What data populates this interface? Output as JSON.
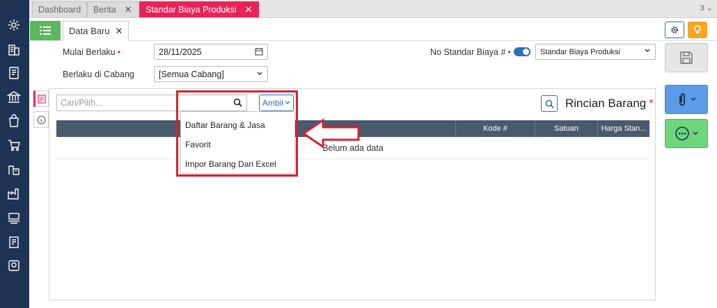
{
  "tabs": [
    {
      "label": "Dashboard",
      "closable": false
    },
    {
      "label": "Berita",
      "closable": true
    },
    {
      "label": "Standar Biaya Produksi",
      "closable": true,
      "active": true
    }
  ],
  "tab_count": "3",
  "doc_tab": {
    "label": "Data Baru"
  },
  "form": {
    "mulai_berlaku_label": "Mulai Berlaku",
    "mulai_berlaku_value": "28/11/2025",
    "berlaku_cabang_label": "Berlaku di Cabang",
    "berlaku_cabang_value": "[Semua Cabang]",
    "no_standar_label": "No Standar Biaya #",
    "no_standar_value": "Standar Biaya Produksi",
    "required_mark": "•"
  },
  "search": {
    "placeholder": "Cari/Pilih...",
    "ambil_label": "Ambil"
  },
  "rincian": {
    "title": "Rincian Barang",
    "required_mark": "*"
  },
  "table": {
    "columns": [
      "Kode #",
      "Satuan",
      "Harga Stan..."
    ],
    "empty_text": "Belum ada data"
  },
  "dropdown": {
    "items": [
      "Daftar Barang & Jasa",
      "Favorit",
      "Impor Barang Dari Excel"
    ]
  },
  "colors": {
    "accent": "#e8235a",
    "primary": "#2c6fb5",
    "sidebar": "#1f3354",
    "highlight": "#d9202c"
  }
}
